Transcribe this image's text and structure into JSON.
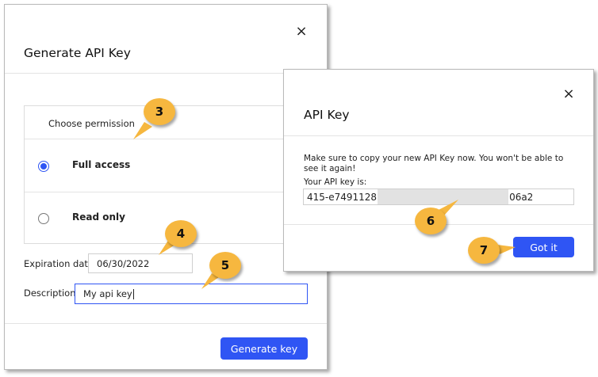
{
  "generate_dialog": {
    "title": "Generate API Key",
    "close_glyph": "×",
    "permission_header": "Choose permission",
    "options": [
      {
        "label": "Full access",
        "selected": true
      },
      {
        "label": "Read only",
        "selected": false
      }
    ],
    "expiration_label": "Expiration date:",
    "expiration_value": "06/30/2022",
    "description_label": "Description:",
    "description_value": "My api key",
    "generate_button": "Generate key"
  },
  "apikey_dialog": {
    "title": "API Key",
    "close_glyph": "×",
    "message": "Make sure to copy your new API Key now. You won't be able to see it again!",
    "key_label": "Your API key is:",
    "key_prefix": "415-e7491128",
    "key_suffix": "06a2",
    "got_it_button": "Got it"
  },
  "callouts": [
    "3",
    "4",
    "5",
    "6",
    "7"
  ],
  "colors": {
    "accent": "#2f55f4",
    "callout": "#f6b73f"
  }
}
